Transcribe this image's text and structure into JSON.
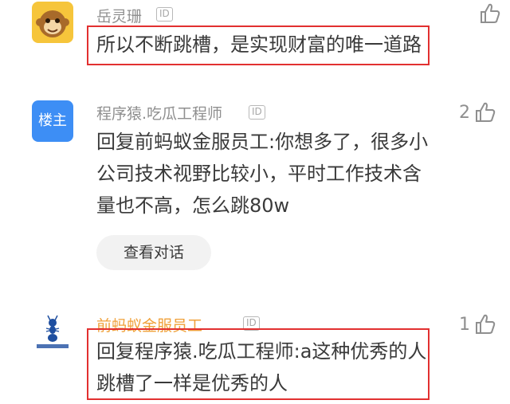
{
  "comments": [
    {
      "username": "岳灵珊",
      "id_badge": "ID",
      "content_lines": [
        "所以不断跳槽，是实现财富的唯一道路"
      ],
      "likes": "",
      "avatar_icon": "monkey-avatar"
    },
    {
      "username": "程序猿.吃瓜工程师",
      "id_badge": "ID",
      "avatar_label": "楼主",
      "content_lines": [
        "回复前蚂蚁金服员工:你想多了，很多小",
        "公司技术视野比较小，平时工作技术含",
        "量也不高，怎么跳80w"
      ],
      "likes": "2",
      "view_conversation": "查看对话"
    },
    {
      "username": "前蚂蚁金服员工",
      "id_badge": "ID",
      "content_lines": [
        "回复程序猿.吃瓜工程师:a这种优秀的人",
        "跳槽了一样是优秀的人"
      ],
      "likes": "1",
      "avatar_icon": "ant-logo-avatar"
    }
  ],
  "colors": {
    "highlight": "#e23030",
    "username_gray": "#8f8f8f",
    "username_orange": "#f0a13a",
    "owner_badge_blue": "#3d8ef5"
  }
}
